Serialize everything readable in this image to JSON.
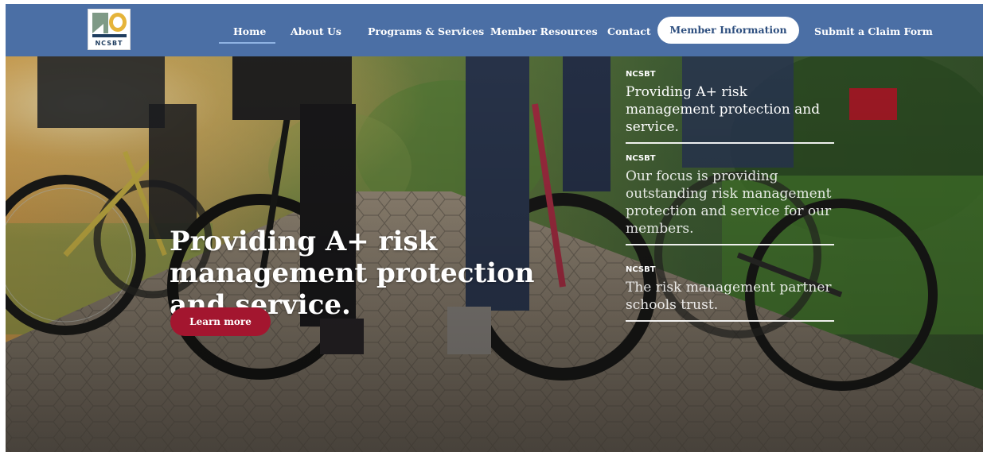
{
  "logo": {
    "text": "NCSBT"
  },
  "nav": {
    "items": [
      {
        "id": "home",
        "label": "Home",
        "active": true
      },
      {
        "id": "about",
        "label": "About Us"
      },
      {
        "id": "programs",
        "label": "Programs & Services"
      },
      {
        "id": "resources",
        "label": "Member Resources"
      },
      {
        "id": "contact",
        "label": "Contact"
      }
    ],
    "cta_label": "Member Information",
    "claim_label": "Submit a Claim Form"
  },
  "hero": {
    "heading": "Providing A+ risk management protection and service.",
    "button_label": "Learn more"
  },
  "slides": [
    {
      "tag": "NCSBT",
      "text": "Providing A+ risk management protection and service."
    },
    {
      "tag": "NCSBT",
      "text": "Our focus is providing outstanding risk management protection and service for our members."
    },
    {
      "tag": "NCSBT",
      "text": "The risk management partner schools trust."
    }
  ],
  "colors": {
    "nav_bg": "#4b6fa5",
    "cta_bg": "#ffffff",
    "cta_text": "#2e4f7f",
    "button_bg": "#a3162f",
    "logo_accent": "#e5b43a"
  }
}
